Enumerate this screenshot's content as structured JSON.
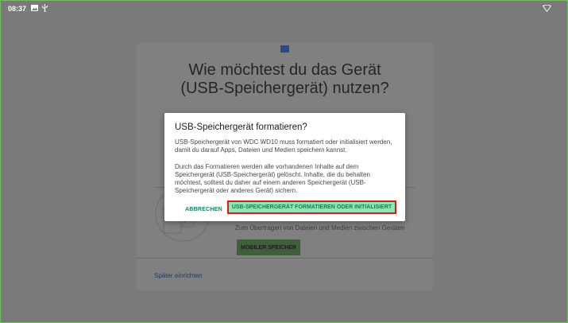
{
  "statusbar": {
    "time": "08:37",
    "icons": [
      "image-icon",
      "usb-icon",
      "wifi-icon"
    ]
  },
  "setup": {
    "headline_line1": "Wie möchtest du das Gerät",
    "headline_line2": "(USB-Speichergerät) nutzen?",
    "description": "Zum Übertragen von Dateien und Medien zwischen Geräten",
    "mobile_storage_button": "MOBILER SPEICHER",
    "later_link": "Später einrichten"
  },
  "dialog": {
    "title": "USB-Speichergerät formatieren?",
    "body1": "USB-Speichergerät von WDC WD10 muss formatiert oder initialisiert werden, damit du darauf Apps, Dateien und Medien speichern kannst.",
    "body2": "Durch das Formatieren werden alle vorhandenen Inhalte auf dem Speichergerät (USB-Speichergerät) gelöscht. Inhalte, die du behalten möchtest, solltest du daher auf einem anderen Speichergerät (USB-Speichergerät oder anderes Gerät) sichern.",
    "cancel_label": "ABBRECHEN",
    "format_label": "USB-SPEICHERGERÄT FORMATIEREN ODER INITIALISIERT"
  },
  "colors": {
    "accent": "#1a8a6a",
    "highlight_border": "#e01818",
    "format_button_bg": "#8ee6b6"
  }
}
